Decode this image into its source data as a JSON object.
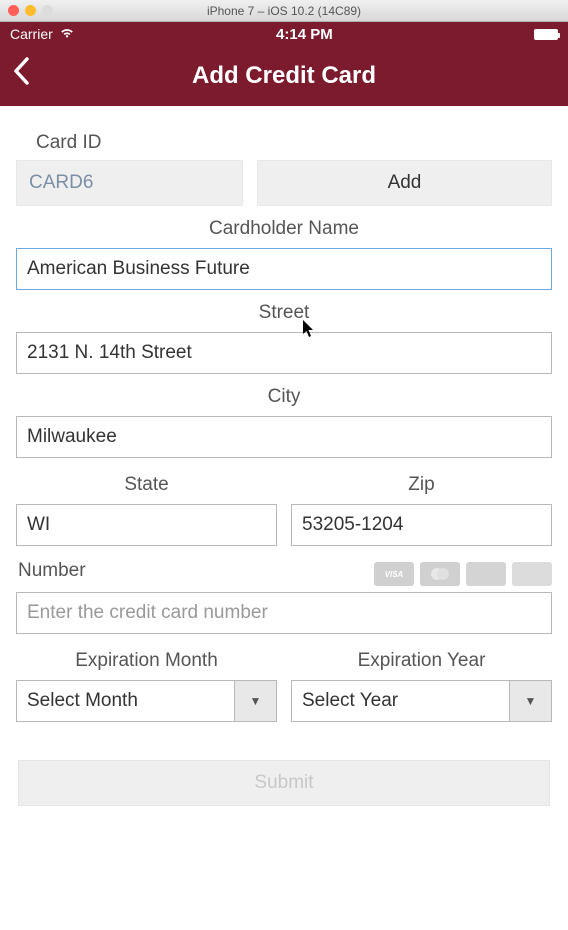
{
  "mac": {
    "title": "iPhone 7 – iOS 10.2 (14C89)"
  },
  "status": {
    "carrier": "Carrier",
    "time": "4:14 PM"
  },
  "nav": {
    "title": "Add Credit Card"
  },
  "form": {
    "card_id_label": "Card ID",
    "card_id_value": "CARD6",
    "add_label": "Add",
    "cardholder_label": "Cardholder Name",
    "cardholder_value": "American Business Future",
    "street_label": "Street",
    "street_value": "2131 N. 14th Street",
    "city_label": "City",
    "city_value": "Milwaukee",
    "state_label": "State",
    "state_value": "WI",
    "zip_label": "Zip",
    "zip_value": "53205-1204",
    "number_label": "Number",
    "number_placeholder": "Enter the credit card number",
    "exp_month_label": "Expiration Month",
    "exp_month_value": "Select Month",
    "exp_year_label": "Expiration Year",
    "exp_year_value": "Select Year",
    "submit_label": "Submit"
  },
  "card_brands": {
    "visa": "VISA",
    "mc": "●●",
    "amex": "▭",
    "disc": "▭"
  }
}
